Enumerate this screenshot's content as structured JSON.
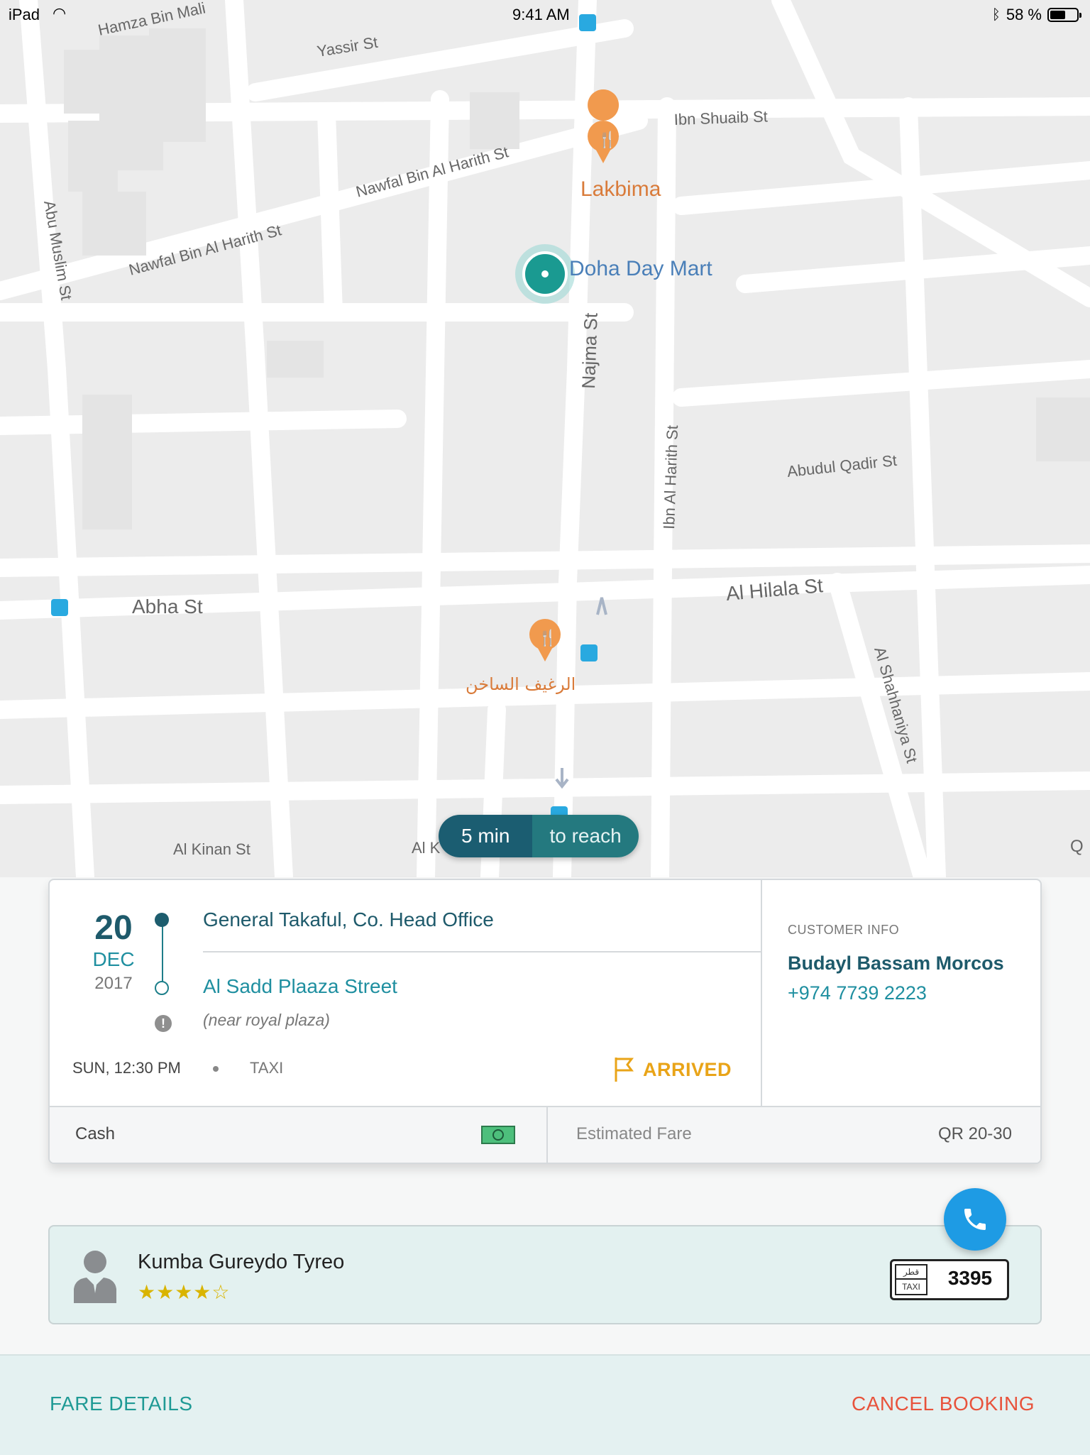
{
  "status_bar": {
    "device": "iPad",
    "time": "9:41 AM",
    "battery": "58 %",
    "battery_level": 0.58
  },
  "map": {
    "streets": [
      "Hamza Bin Mali",
      "Yassir St",
      "Ibn Shuaib St",
      "Nawfal Bin Al Harith St",
      "Nawfal Bin Al Harith St",
      "Abu Muslim St",
      "Najma St",
      "Ibn Al Harith St",
      "Abudul Qadir St",
      "Abha St",
      "Al Hilala St",
      "Al Shahhaniya St",
      "Al Kinan St",
      "Al K",
      "Q"
    ],
    "places": {
      "restaurant1": "Lakbima",
      "store": "Doha Day Mart",
      "restaurant2": "الرغيف الساخن"
    },
    "eta": {
      "time": "5 min",
      "label": "to reach"
    }
  },
  "booking": {
    "date": {
      "day": "20",
      "month": "DEC",
      "year": "2017"
    },
    "pickup": "General Takaful, Co. Head Office",
    "dropoff": "Al Sadd Plaaza Street",
    "dropoff_note": "(near royal plaza)",
    "time": "SUN, 12:30 PM",
    "vehicle": "TAXI",
    "status": "ARRIVED",
    "status_color": "#e9a418",
    "customer": {
      "label": "CUSTOMER INFO",
      "name": "Budayl Bassam Morcos",
      "phone": "+974 7739 2223"
    },
    "payment": {
      "method": "Cash",
      "fare_label": "Estimated Fare",
      "fare_value": "QR 20-30"
    }
  },
  "driver": {
    "name": "Kumba Gureydo Tyreo",
    "rating": 4,
    "rating_max": 5,
    "rating_stars": "★★★★☆",
    "plate": {
      "country": "قطر",
      "type": "TAXI",
      "number": "3395"
    }
  },
  "actions": {
    "fare_details": "FARE DETAILS",
    "cancel_booking": "CANCEL BOOKING"
  },
  "colors": {
    "primary": "#1e5a6b",
    "accent": "#1f8fa0",
    "cancel": "#e8533c",
    "call": "#1e9be4"
  }
}
